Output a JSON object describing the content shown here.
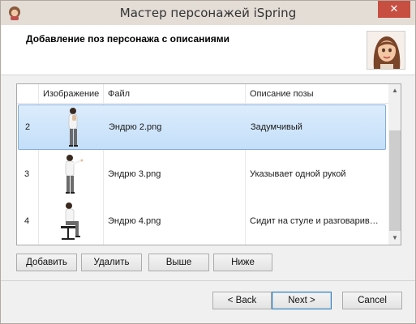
{
  "window": {
    "title": "Мастер персонажей iSpring",
    "close_glyph": "✕"
  },
  "header": {
    "title": "Добавление поз персонажа с описаниями",
    "avatar_icon": "character-portrait-icon"
  },
  "table": {
    "columns": [
      "Изображение",
      "Файл",
      "Описание позы"
    ],
    "rows": [
      {
        "index": "2",
        "file": "Эндрю 2.png",
        "description": "Задумчивый",
        "selected": true,
        "pose": "thinking"
      },
      {
        "index": "3",
        "file": "Эндрю 3.png",
        "description": "Указывает одной рукой",
        "selected": false,
        "pose": "pointing"
      },
      {
        "index": "4",
        "file": "Эндрю 4.png",
        "description": "Сидит на стуле и разговарив…",
        "selected": false,
        "pose": "sitting"
      }
    ]
  },
  "actions": {
    "add": "Добавить",
    "delete": "Удалить",
    "up": "Выше",
    "down": "Ниже"
  },
  "footer": {
    "back": "< Back",
    "next": "Next >",
    "cancel": "Cancel"
  },
  "colors": {
    "selection": "#c4dff9",
    "close": "#c74f41",
    "titlebar": "#e3ddd6"
  }
}
